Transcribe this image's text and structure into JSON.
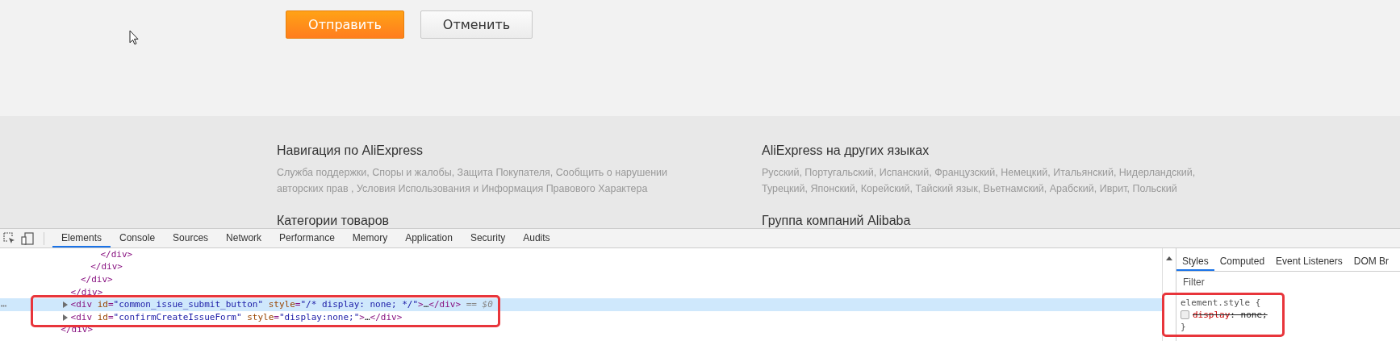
{
  "page": {
    "buttons": [
      {
        "label": "Отправить",
        "kind": "primary"
      },
      {
        "label": "Отменить",
        "kind": "secondary"
      }
    ],
    "footer": [
      {
        "title": "Навигация по AliExpress",
        "text": "Служба поддержки, Споры и жалобы, Защита Покупателя, Сообщить о нарушении авторских прав , Условия Использования и Информация Правового Характера",
        "next_title": "Категории товаров"
      },
      {
        "title": "AliExpress на других языках",
        "text": "Русский, Португальский, Испанский, Французский, Немецкий, Итальянский, Нидерландский, Турецкий, Японский, Корейский, Тайский язык, Вьетнамский, Арабский, Иврит, Польский",
        "next_title": "Группа компаний Alibaba"
      }
    ]
  },
  "devtools": {
    "tabs": [
      {
        "label": "Elements",
        "selected": true
      },
      {
        "label": "Console",
        "selected": false
      },
      {
        "label": "Sources",
        "selected": false
      },
      {
        "label": "Network",
        "selected": false
      },
      {
        "label": "Performance",
        "selected": false
      },
      {
        "label": "Memory",
        "selected": false
      },
      {
        "label": "Application",
        "selected": false
      },
      {
        "label": "Security",
        "selected": false
      },
      {
        "label": "Audits",
        "selected": false
      }
    ],
    "dom_tree": [
      {
        "children": [
          {
            "children": [
              {
                "children": [
                  {
                    "children": [
                      {
                        "tokens": [
                          {
                            "kind": "tag",
                            "text": "</div>"
                          }
                        ],
                        "selected": false
                      }
                    ]
                  },
                  {
                    "tokens": [
                      {
                        "kind": "tag",
                        "text": "</div>"
                      }
                    ],
                    "selected": false
                  }
                ]
              },
              {
                "tokens": [
                  {
                    "kind": "tag",
                    "text": "</div>"
                  }
                ],
                "selected": false
              }
            ]
          },
          {
            "tokens": [
              {
                "kind": "tag",
                "text": "</div>"
              }
            ],
            "selected": false
          },
          {
            "tokens": [
              {
                "kind": "tag",
                "text": "<div"
              },
              {
                "kind": "attr",
                "text": " id"
              },
              {
                "kind": "tag",
                "text": "="
              },
              {
                "kind": "value",
                "text": "\"common_issue_submit_button\""
              },
              {
                "kind": "attr",
                "text": " style"
              },
              {
                "kind": "tag",
                "text": "="
              },
              {
                "kind": "value",
                "text": "\"/* display: none; */\""
              },
              {
                "kind": "tag",
                "text": ">"
              },
              {
                "kind": "text",
                "text": "…"
              },
              {
                "kind": "tag",
                "text": "</div>"
              },
              {
                "kind": "ref",
                "text": " == $0"
              }
            ],
            "expanded": false,
            "selected": true,
            "highlighted": true
          },
          {
            "tokens": [
              {
                "kind": "tag",
                "text": "<div"
              },
              {
                "kind": "attr",
                "text": " id"
              },
              {
                "kind": "tag",
                "text": "="
              },
              {
                "kind": "value",
                "text": "\"confirmCreateIssueForm\""
              },
              {
                "kind": "attr",
                "text": " style"
              },
              {
                "kind": "tag",
                "text": "="
              },
              {
                "kind": "value",
                "text": "\"display:none;\""
              },
              {
                "kind": "tag",
                "text": ">"
              },
              {
                "kind": "text",
                "text": "…"
              },
              {
                "kind": "tag",
                "text": "</div>"
              }
            ],
            "expanded": false,
            "selected": false,
            "highlighted": true
          }
        ]
      },
      {
        "tokens": [
          {
            "kind": "tag",
            "text": "</div>"
          }
        ],
        "selected": false
      }
    ],
    "styles": {
      "tabs": [
        {
          "label": "Styles",
          "selected": true
        },
        {
          "label": "Computed",
          "selected": false
        },
        {
          "label": "Event Listeners",
          "selected": false
        },
        {
          "label": "DOM Br",
          "selected": false
        }
      ],
      "filter_placeholder": "Filter",
      "rule": {
        "selector": "element.style {",
        "highlighted": true,
        "close": "}",
        "properties": [
          {
            "name": "display",
            "value": ": none;",
            "checked": false
          }
        ]
      }
    }
  }
}
